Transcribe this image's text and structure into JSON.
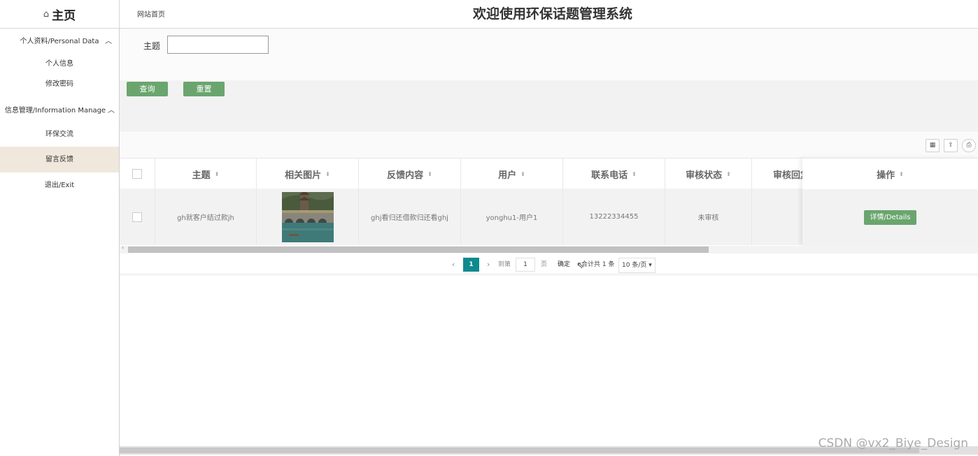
{
  "brand": {
    "icon": "home-icon",
    "label": "主页"
  },
  "breadcrumb": "网站首页",
  "page_title": "欢迎使用环保话题管理系统",
  "sidebar": {
    "groups": [
      {
        "label": "个人资料/Personal Data",
        "items": [
          "个人信息",
          "修改密码"
        ]
      },
      {
        "label": "信息管理/Information Manage",
        "items": [
          "环保交流",
          "留言反馈"
        ]
      }
    ],
    "exit": "退出/Exit",
    "active": "留言反馈"
  },
  "search": {
    "label": "主题",
    "value": ""
  },
  "buttons": {
    "query": "查询",
    "reset": "重置"
  },
  "table": {
    "headers": [
      "主题",
      "相关图片",
      "反馈内容",
      "用户",
      "联系电话",
      "审核状态",
      "审核回复",
      "操作"
    ],
    "rows": [
      {
        "subject": "gh就客户结过款jh",
        "image": "stone-bridge-photo",
        "content": "ghj看归还借款归还看ghj",
        "user": "yonghu1-用户1",
        "phone": "13222334455",
        "status": "未审核",
        "reply": "",
        "action": "详情/Details"
      }
    ]
  },
  "pagination": {
    "current": "1",
    "goto_label": "到第",
    "page_input": "1",
    "page_unit": "页",
    "confirm": "确定",
    "total": "合计共 1 条",
    "page_size": "10 条/页"
  },
  "watermark": "CSDN @vx2_Biye_Design"
}
